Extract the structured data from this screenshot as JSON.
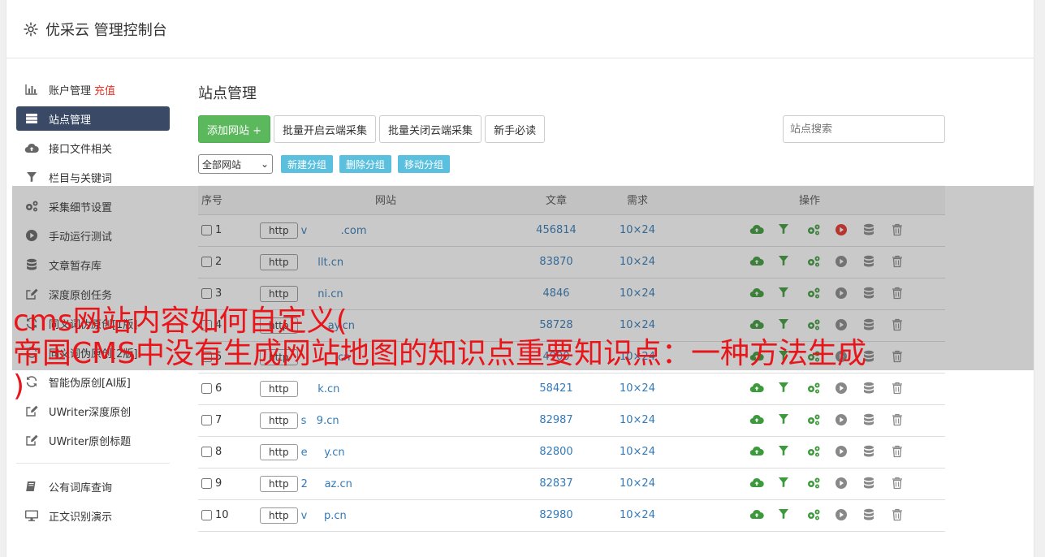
{
  "header": {
    "title": "优采云 管理控制台",
    "icon": "gear-icon"
  },
  "sidebar": {
    "items": [
      {
        "label": "账户管理",
        "extra": "充值",
        "icon": "bar-chart-icon"
      },
      {
        "label": "站点管理",
        "icon": "server-icon",
        "active": true
      },
      {
        "label": "接口文件相关",
        "icon": "cloud-upload-icon"
      },
      {
        "label": "栏目与关键词",
        "icon": "filter-icon"
      },
      {
        "label": "采集细节设置",
        "icon": "cogs-icon"
      },
      {
        "label": "手动运行测试",
        "icon": "play-circle-icon"
      },
      {
        "label": "文章暂存库",
        "icon": "database-icon"
      },
      {
        "label": "深度原创任务",
        "icon": "edit-icon"
      },
      {
        "label": "同义词伪原创[1版]",
        "icon": "refresh-icon"
      },
      {
        "label": "同义词伪原创[2版]",
        "icon": "refresh-icon"
      },
      {
        "label": "智能伪原创[AI版]",
        "icon": "refresh-icon"
      },
      {
        "label": "UWriter深度原创",
        "icon": "edit-icon"
      },
      {
        "label": "UWriter原创标题",
        "icon": "edit-icon"
      }
    ],
    "bottom_items": [
      {
        "label": "公有词库查询",
        "icon": "book-icon"
      },
      {
        "label": "正文识别演示",
        "icon": "monitor-icon"
      }
    ]
  },
  "main": {
    "title": "站点管理",
    "buttons": {
      "add": "添加网站 +",
      "batch_open": "批量开启云端采集",
      "batch_close": "批量关闭云端采集",
      "guide": "新手必读"
    },
    "search_placeholder": "站点搜索",
    "group_select": "全部网站",
    "group_buttons": {
      "new": "新建分组",
      "delete": "删除分组",
      "move": "移动分组"
    }
  },
  "table": {
    "headers": {
      "idx": "序号",
      "site": "网站",
      "articles": "文章",
      "demand": "需求",
      "ops": "操作"
    },
    "http_label": "http",
    "rows": [
      {
        "idx": "1",
        "domain": "v          .com",
        "articles": "456814",
        "demand": "10×24",
        "active": true
      },
      {
        "idx": "2",
        "domain": "     llt.cn",
        "articles": "83870",
        "demand": "10×24"
      },
      {
        "idx": "3",
        "domain": "     ni.cn",
        "articles": "4846",
        "demand": "10×24"
      },
      {
        "idx": "4",
        "domain": "        ay.cn",
        "articles": "58728",
        "demand": "10×24"
      },
      {
        "idx": "5",
        "domain": "          .cn",
        "articles": "4900",
        "demand": "10×24"
      },
      {
        "idx": "6",
        "domain": "     k.cn",
        "articles": "58421",
        "demand": "10×24"
      },
      {
        "idx": "7",
        "domain": "s   9.cn",
        "articles": "82987",
        "demand": "10×24"
      },
      {
        "idx": "8",
        "domain": "e     y.cn",
        "articles": "82800",
        "demand": "10×24"
      },
      {
        "idx": "9",
        "domain": "2     az.cn",
        "articles": "82837",
        "demand": "10×24"
      },
      {
        "idx": "10",
        "domain": "v     p.cn",
        "articles": "82980",
        "demand": "10×24"
      }
    ]
  },
  "overlay_caption": {
    "line1": "cms网站内容如何自定义(",
    "line2": "帝国CMS中没有生成网站地图的知识点重要知识点：一种方法生成",
    "line3": ")"
  },
  "colors": {
    "sidebar_active": "#3a4a66",
    "green": "#5cb85c",
    "info": "#5bc0de",
    "link": "#337ab7",
    "caption": "#e8151b",
    "run_active": "#e5332a"
  }
}
